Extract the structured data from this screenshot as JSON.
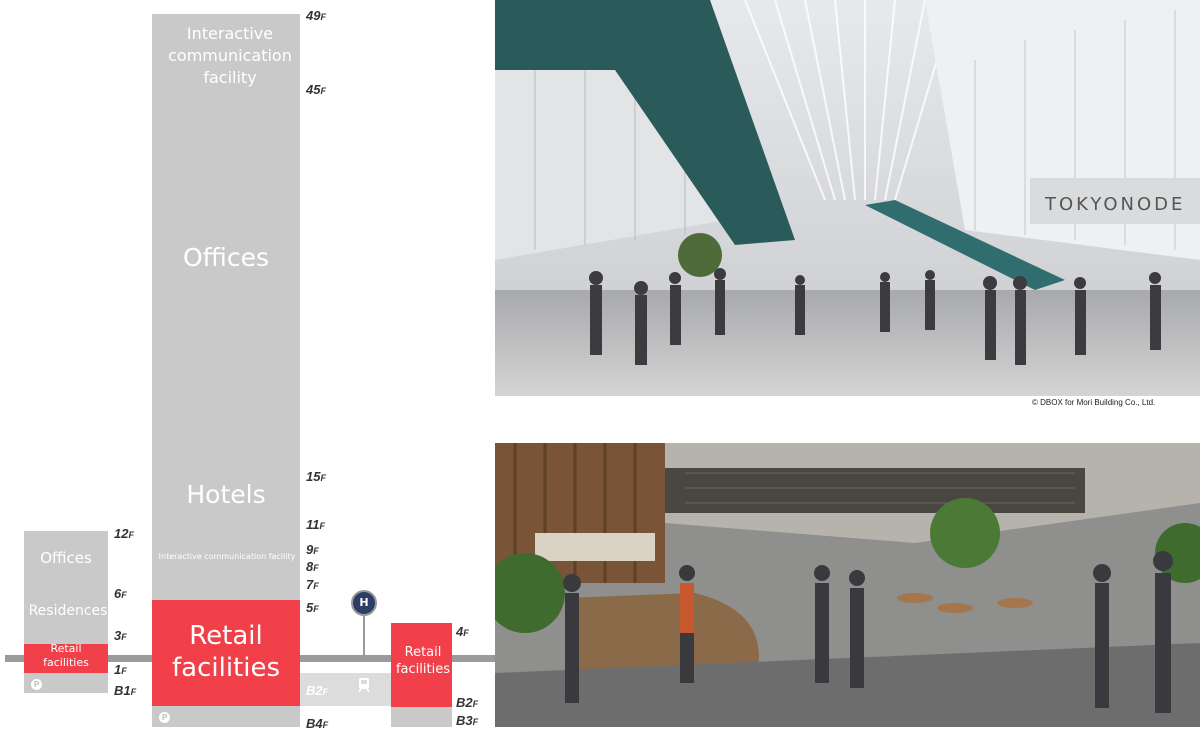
{
  "diagram": {
    "tower_left": {
      "offices": "Offices",
      "residences": "Residences",
      "retail": "Retail facilities",
      "floors": {
        "f12": "12",
        "f6": "6",
        "f3": "3",
        "f1": "1",
        "b1": "B1"
      }
    },
    "tower_main": {
      "interactive_top": "Interactive communication facility",
      "offices": "Offices",
      "hotels": "Hotels",
      "interactive_small": "Interactive communication facility",
      "retail": "Retail facilities",
      "floors": {
        "f49": "49",
        "f45": "45",
        "f15": "15",
        "f11": "11",
        "f9": "9",
        "f8": "8",
        "f7": "7",
        "f5": "5",
        "b2": "B2",
        "b4": "B4"
      }
    },
    "tower_right": {
      "retail": "Retail facilities",
      "floors": {
        "f4": "4",
        "b2": "B2",
        "b3": "B3"
      }
    },
    "floor_suffix": "F",
    "icons": {
      "parking": "parking-icon",
      "hub": "hub-icon",
      "train": "train-icon"
    },
    "icon_text": {
      "parking": "P",
      "hub": "H"
    },
    "colors": {
      "building": "#c9c9c9",
      "retail": "#f2404a",
      "ground": "#9a9a9a",
      "hub_accent": "#2c3e66"
    }
  },
  "photos": {
    "top": {
      "caption": "© DBOX for Mori Building Co., Ltd.",
      "sign": "TOKYONODE"
    },
    "bottom": {}
  }
}
